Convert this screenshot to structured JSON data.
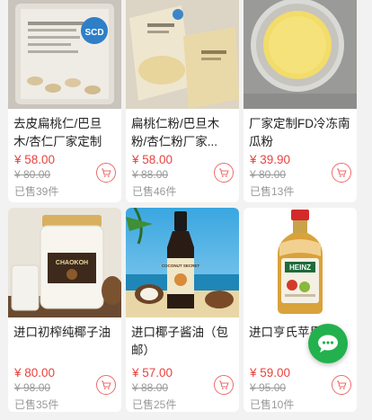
{
  "products": [
    {
      "name": "去皮扁桃仁/巴旦木/杏仁厂家定制",
      "price": "¥ 58.00",
      "original_price": "¥ 80.00",
      "sold": "已售39件",
      "image_icon": "almond-bag-image"
    },
    {
      "name": "扁桃仁粉/巴旦木粉/杏仁粉厂家...",
      "price": "¥ 58.00",
      "original_price": "¥ 88.00",
      "sold": "已售46件",
      "image_icon": "almond-flour-bags-image"
    },
    {
      "name": "厂家定制FD冷冻南瓜粉",
      "price": "¥ 39.90",
      "original_price": "¥ 80.00",
      "sold": "已售13件",
      "image_icon": "pumpkin-powder-bowl-image"
    },
    {
      "name": "进口初榨纯椰子油",
      "price": "¥ 80.00",
      "original_price": "¥ 98.00",
      "sold": "已售35件",
      "image_icon": "coconut-oil-jar-image"
    },
    {
      "name": "进口椰子酱油（包邮）",
      "price": "¥ 57.00",
      "original_price": "¥ 88.00",
      "sold": "已售25件",
      "image_icon": "coconut-aminos-bottle-image"
    },
    {
      "name": "进口亨氏苹果醋",
      "price": "¥ 59.00",
      "original_price": "¥ 95.00",
      "sold": "已售10件",
      "image_icon": "apple-cider-vinegar-bottle-image"
    }
  ],
  "image_text": {
    "scd_badge": "SCD",
    "coconut_brand": "CHAOKOH",
    "soy_brand": "COCONUT SECRET",
    "vinegar_brand": "HEINZ"
  },
  "colors": {
    "price": "#e8433f",
    "muted": "#999999",
    "chat_fab": "#22b14c"
  },
  "icons": {
    "cart": "cart-icon",
    "chat": "chat-icon"
  }
}
